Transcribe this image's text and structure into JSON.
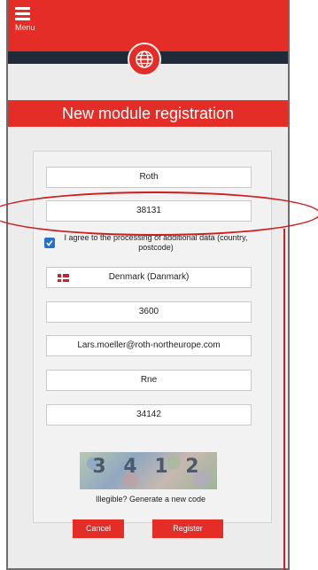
{
  "header": {
    "menu_label": "Menu"
  },
  "page": {
    "title": "New module registration"
  },
  "form": {
    "company": "Roth",
    "number": "38131",
    "consent_text": "I agree to the processing of additional data (country, postcode)",
    "consent_checked": true,
    "country": "Denmark (Danmark)",
    "postcode": "3600",
    "email": "Lars.moeller@roth-northeurope.com",
    "name": "Rne",
    "code": "34142"
  },
  "captcha": {
    "regen_text": "Illegible? Generate a new code"
  },
  "buttons": {
    "cancel_label": "Cancel",
    "register_label": "Register"
  },
  "colors": {
    "brand_red": "#e52d27",
    "dark_band": "#1f2b38",
    "checkbox_blue": "#2670c9",
    "annotation_red": "#cc1f1f"
  },
  "icons": {
    "menu": "hamburger-icon",
    "logo": "globe-icon",
    "flag": "denmark-flag-icon",
    "check": "check-icon"
  }
}
